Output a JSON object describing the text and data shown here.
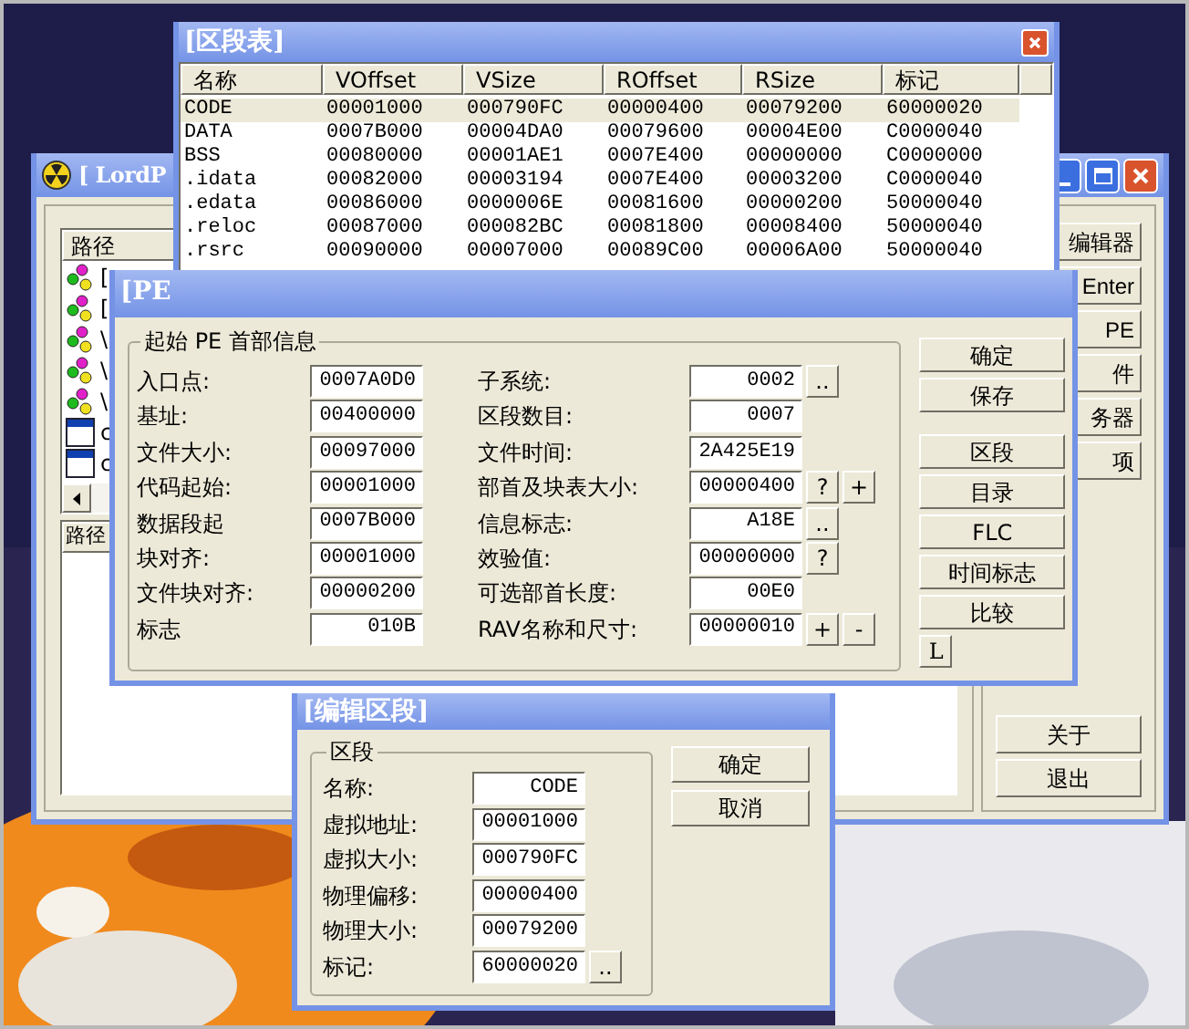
{
  "main_window": {
    "title": "[ LordP",
    "tree_header": "路径",
    "tree_rows": [
      {
        "kind": "process",
        "label": "["
      },
      {
        "kind": "process",
        "label": "["
      },
      {
        "kind": "process",
        "label": "\\"
      },
      {
        "kind": "process",
        "label": "\\"
      },
      {
        "kind": "process",
        "label": "\\"
      },
      {
        "kind": "module",
        "label": "c"
      },
      {
        "kind": "module",
        "label": "c"
      }
    ],
    "list_header": "路径",
    "side_buttons": [
      "编辑器",
      "Enter",
      "PE",
      "件",
      "务器",
      "项"
    ],
    "bottom_buttons": [
      "关于",
      "退出"
    ]
  },
  "section_table": {
    "title": "[区段表]",
    "columns": [
      "名称",
      "VOffset",
      "VSize",
      "ROffset",
      "RSize",
      "标记"
    ],
    "rows": [
      {
        "selected": true,
        "cells": [
          "CODE",
          "00001000",
          "000790FC",
          "00000400",
          "00079200",
          "60000020"
        ]
      },
      {
        "selected": false,
        "cells": [
          "DATA",
          "0007B000",
          "00004DA0",
          "00079600",
          "00004E00",
          "C0000040"
        ]
      },
      {
        "selected": false,
        "cells": [
          "BSS",
          "00080000",
          "00001AE1",
          "0007E400",
          "00000000",
          "C0000000"
        ]
      },
      {
        "selected": false,
        "cells": [
          ".idata",
          "00082000",
          "00003194",
          "0007E400",
          "00003200",
          "C0000040"
        ]
      },
      {
        "selected": false,
        "cells": [
          ".edata",
          "00086000",
          "0000006E",
          "00081600",
          "00000200",
          "50000040"
        ]
      },
      {
        "selected": false,
        "cells": [
          ".reloc",
          "00087000",
          "000082BC",
          "00081800",
          "00008400",
          "50000040"
        ]
      },
      {
        "selected": false,
        "cells": [
          ".rsrc",
          "00090000",
          "00007000",
          "00089C00",
          "00006A00",
          "50000040"
        ]
      }
    ]
  },
  "pe_editor": {
    "title": "[PE",
    "group_title": "起始 PE 首部信息",
    "left_fields": [
      {
        "label": "入口点:",
        "value": "0007A0D0"
      },
      {
        "label": "基址:",
        "value": "00400000"
      },
      {
        "label": "文件大小:",
        "value": "00097000"
      },
      {
        "label": "代码起始:",
        "value": "00001000"
      },
      {
        "label": "数据段起",
        "value": "0007B000"
      },
      {
        "label": "块对齐:",
        "value": "00001000"
      },
      {
        "label": "文件块对齐:",
        "value": "00000200"
      },
      {
        "label": "标志",
        "value": "010B"
      }
    ],
    "right_fields": [
      {
        "label": "子系统:",
        "value": "0002",
        "buttons": [
          ".."
        ]
      },
      {
        "label": "区段数目:",
        "value": "0007"
      },
      {
        "label": "文件时间:",
        "value": "2A425E19"
      },
      {
        "label": "部首及块表大小:",
        "value": "00000400",
        "buttons": [
          "?",
          "+"
        ]
      },
      {
        "label": "信息标志:",
        "value": "A18E",
        "buttons": [
          ".."
        ]
      },
      {
        "label": "效验值:",
        "value": "00000000",
        "buttons": [
          "?"
        ]
      },
      {
        "label": "可选部首长度:",
        "value": "00E0"
      },
      {
        "label": "RAV名称和尺寸:",
        "value": "00000010",
        "buttons": [
          "+",
          "-"
        ]
      }
    ],
    "button_groups": [
      [
        "确定",
        "保存"
      ],
      [
        "区段",
        "目录",
        "FLC",
        "时间标志",
        "比较"
      ]
    ],
    "small_button": "L"
  },
  "edit_section": {
    "title": "[编辑区段]",
    "group_title": "区段",
    "fields": [
      {
        "label": "名称:",
        "value": "CODE"
      },
      {
        "label": "虚拟地址:",
        "value": "00001000"
      },
      {
        "label": "虚拟大小:",
        "value": "000790FC"
      },
      {
        "label": "物理偏移:",
        "value": "00000400"
      },
      {
        "label": "物理大小:",
        "value": "00079200"
      },
      {
        "label": "标记:",
        "value": "60000020",
        "buttons": [
          ".."
        ]
      }
    ],
    "buttons": [
      "确定",
      "取消"
    ]
  }
}
